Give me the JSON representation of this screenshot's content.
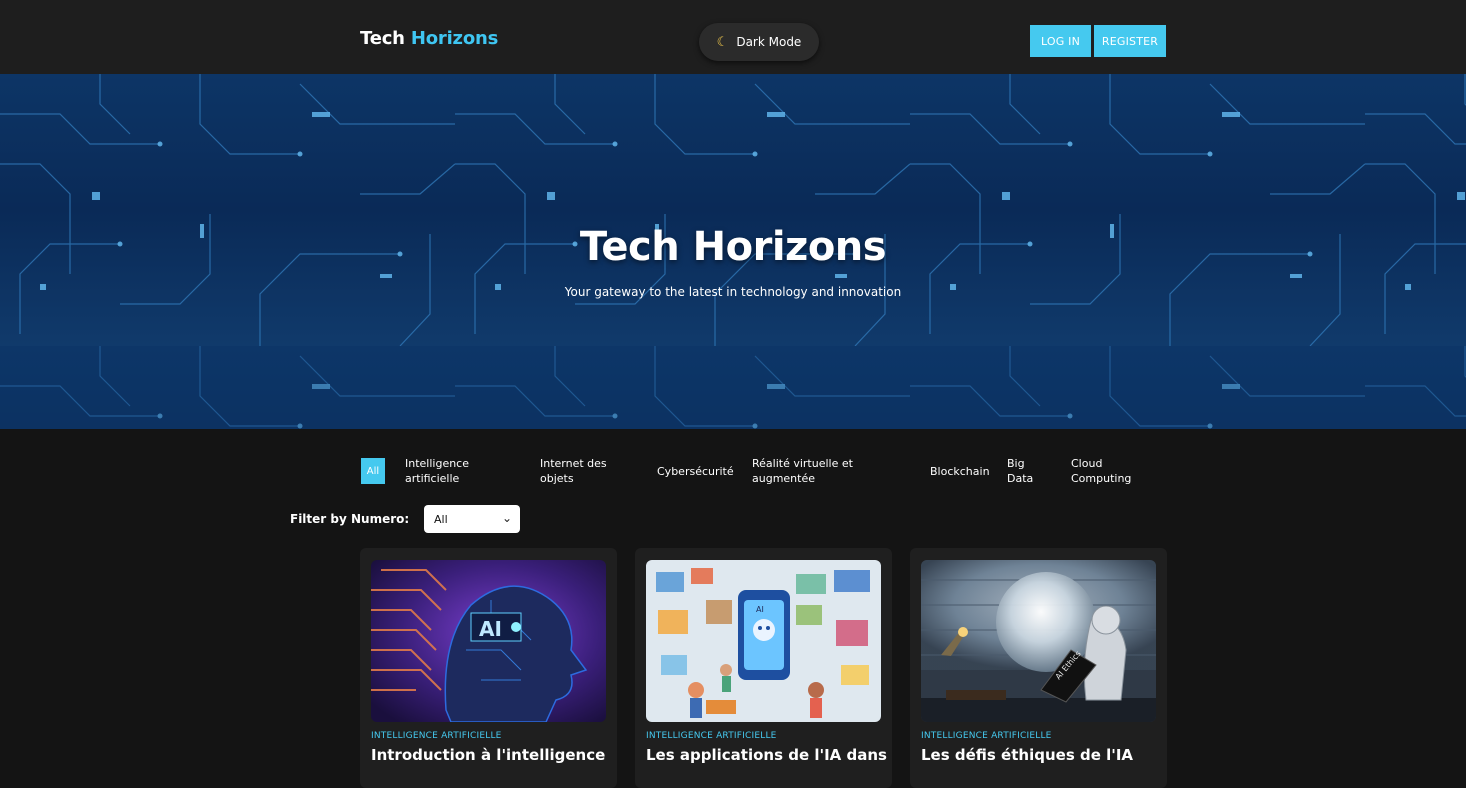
{
  "header": {
    "brand_part1": "Tech",
    "brand_part2": "Horizons",
    "dark_mode_label": "Dark Mode",
    "login_label": "LOG IN",
    "register_label": "REGISTER"
  },
  "hero": {
    "title": "Tech Horizons",
    "subtitle": "Your gateway to the latest in technology and innovation"
  },
  "categories": {
    "all": "All",
    "items": [
      {
        "line1": "Intelligence",
        "line2": "artificielle"
      },
      {
        "line1": "Internet des",
        "line2": "objets"
      },
      {
        "line1": "Cybersécurité",
        "line2": ""
      },
      {
        "line1": "Réalité virtuelle et",
        "line2": "augmentée"
      },
      {
        "line1": "Blockchain",
        "line2": ""
      },
      {
        "line1": "Big",
        "line2": "Data"
      },
      {
        "line1": "Cloud",
        "line2": "Computing"
      }
    ]
  },
  "filter": {
    "label": "Filter by Numero:",
    "selected": "All"
  },
  "cards": [
    {
      "category": "INTELLIGENCE ARTIFICIELLE",
      "title": "Introduction à l'intelligence",
      "image_text": "AI"
    },
    {
      "category": "INTELLIGENCE ARTIFICIELLE",
      "title": "Les applications de l'IA dans",
      "image_text": "AI"
    },
    {
      "category": "INTELLIGENCE ARTIFICIELLE",
      "title": "Les défis éthiques de l'IA",
      "image_text": "AI Ethics"
    }
  ],
  "colors": {
    "accent": "#45c9ef",
    "header_bg": "#1e1e1e",
    "page_bg": "#141414",
    "card_bg": "#1f1f1f",
    "hero_bg": "#0b2a55"
  }
}
